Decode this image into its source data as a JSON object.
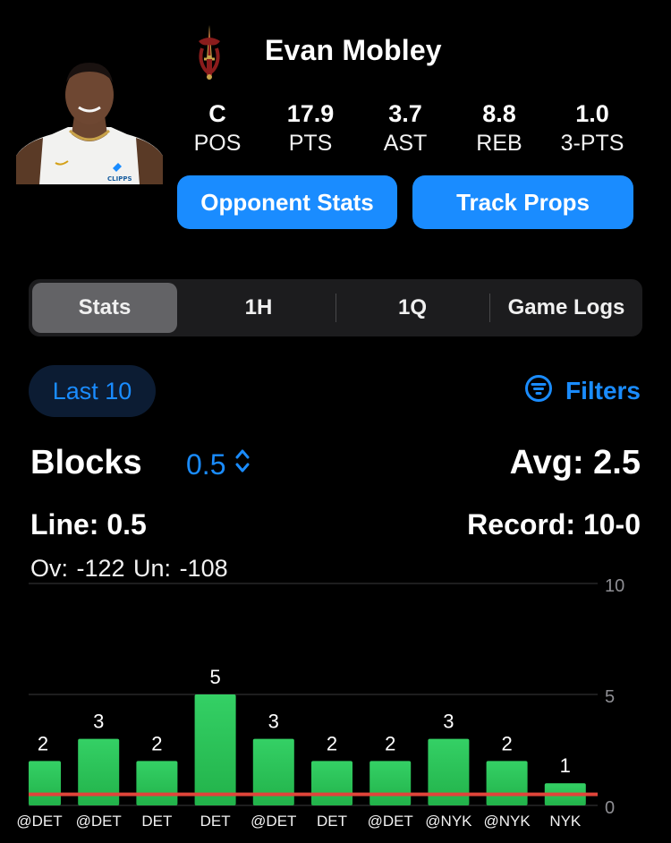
{
  "player": {
    "name": "Evan Mobley",
    "photo_jersey_text": "CLIPPS",
    "stats": [
      {
        "value": "C",
        "label": "POS"
      },
      {
        "value": "17.9",
        "label": "PTS"
      },
      {
        "value": "3.7",
        "label": "AST"
      },
      {
        "value": "8.8",
        "label": "REB"
      },
      {
        "value": "1.0",
        "label": "3-PTS"
      }
    ]
  },
  "icons": {
    "team_logo": "cavaliers-sword-logo-icon",
    "filters": "filter-lines-icon",
    "line_selector": "chevron-up-down-icon"
  },
  "buttons": {
    "opponent_stats": "Opponent Stats",
    "track_props": "Track Props"
  },
  "tabs": [
    {
      "label": "Stats",
      "active": true
    },
    {
      "label": "1H",
      "active": false
    },
    {
      "label": "1Q",
      "active": false
    },
    {
      "label": "Game Logs",
      "active": false
    }
  ],
  "range_pill": "Last 10",
  "filters_label": "Filters",
  "prop": {
    "stat": "Blocks",
    "line_value": "0.5",
    "avg": "Avg: 2.5",
    "line_text": "Line: 0.5",
    "record": "Record: 10-0",
    "odds": "Ov: -122  Un: -108"
  },
  "colors": {
    "accent": "#1a8cff",
    "bar": "#34c759",
    "line": "#e0443a",
    "background": "#000000"
  },
  "chart_data": {
    "type": "bar",
    "categories": [
      "@DET",
      "@DET",
      "DET",
      "DET",
      "@DET",
      "DET",
      "@DET",
      "@NYK",
      "@NYK",
      "NYK"
    ],
    "values": [
      2,
      3,
      2,
      5,
      3,
      2,
      2,
      3,
      2,
      1
    ],
    "ylim": [
      0,
      10
    ],
    "yticks": [
      0,
      5,
      10
    ],
    "threshold": 0.5,
    "grid": true
  }
}
